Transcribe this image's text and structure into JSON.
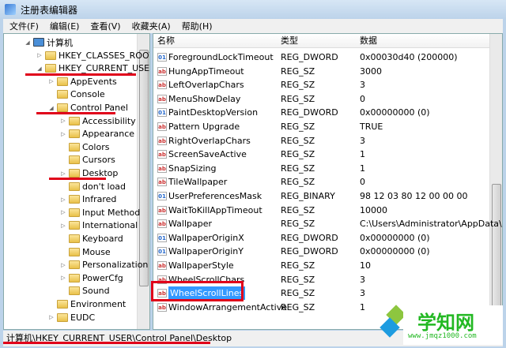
{
  "window": {
    "title": "注册表编辑器"
  },
  "menu": [
    "文件(F)",
    "编辑(E)",
    "查看(V)",
    "收藏夹(A)",
    "帮助(H)"
  ],
  "tree": [
    {
      "label": "计算机",
      "level": 0,
      "arrow": "◢",
      "icon": "computer"
    },
    {
      "label": "HKEY_CLASSES_ROOT",
      "level": 1,
      "arrow": "▷"
    },
    {
      "label": "HKEY_CURRENT_USER",
      "level": 1,
      "arrow": "◢"
    },
    {
      "label": "AppEvents",
      "level": 2,
      "arrow": "▷"
    },
    {
      "label": "Console",
      "level": 2,
      "arrow": ""
    },
    {
      "label": "Control Panel",
      "level": 2,
      "arrow": "◢"
    },
    {
      "label": "Accessibility",
      "level": 3,
      "arrow": "▷"
    },
    {
      "label": "Appearance",
      "level": 3,
      "arrow": "▷"
    },
    {
      "label": "Colors",
      "level": 3,
      "arrow": ""
    },
    {
      "label": "Cursors",
      "level": 3,
      "arrow": ""
    },
    {
      "label": "Desktop",
      "level": 3,
      "arrow": "▷"
    },
    {
      "label": "don't load",
      "level": 3,
      "arrow": ""
    },
    {
      "label": "Infrared",
      "level": 3,
      "arrow": "▷"
    },
    {
      "label": "Input Method",
      "level": 3,
      "arrow": "▷"
    },
    {
      "label": "International",
      "level": 3,
      "arrow": "▷"
    },
    {
      "label": "Keyboard",
      "level": 3,
      "arrow": ""
    },
    {
      "label": "Mouse",
      "level": 3,
      "arrow": ""
    },
    {
      "label": "Personalization",
      "level": 3,
      "arrow": "▷"
    },
    {
      "label": "PowerCfg",
      "level": 3,
      "arrow": "▷"
    },
    {
      "label": "Sound",
      "level": 3,
      "arrow": ""
    },
    {
      "label": "Environment",
      "level": 2,
      "arrow": ""
    },
    {
      "label": "EUDC",
      "level": 2,
      "arrow": "▷"
    }
  ],
  "columns": [
    "名称",
    "类型",
    "数据"
  ],
  "values": [
    {
      "name": "ForegroundLockTimeout",
      "type": "REG_DWORD",
      "data": "0x00030d40 (200000)",
      "icon": "bin"
    },
    {
      "name": "HungAppTimeout",
      "type": "REG_SZ",
      "data": "3000",
      "icon": "ab"
    },
    {
      "name": "LeftOverlapChars",
      "type": "REG_SZ",
      "data": "3",
      "icon": "ab"
    },
    {
      "name": "MenuShowDelay",
      "type": "REG_SZ",
      "data": "0",
      "icon": "ab"
    },
    {
      "name": "PaintDesktopVersion",
      "type": "REG_DWORD",
      "data": "0x00000000 (0)",
      "icon": "bin"
    },
    {
      "name": "Pattern Upgrade",
      "type": "REG_SZ",
      "data": "TRUE",
      "icon": "ab"
    },
    {
      "name": "RightOverlapChars",
      "type": "REG_SZ",
      "data": "3",
      "icon": "ab"
    },
    {
      "name": "ScreenSaveActive",
      "type": "REG_SZ",
      "data": "1",
      "icon": "ab"
    },
    {
      "name": "SnapSizing",
      "type": "REG_SZ",
      "data": "1",
      "icon": "ab"
    },
    {
      "name": "TileWallpaper",
      "type": "REG_SZ",
      "data": "0",
      "icon": "ab"
    },
    {
      "name": "UserPreferencesMask",
      "type": "REG_BINARY",
      "data": "98 12 03 80 12 00 00 00",
      "icon": "bin"
    },
    {
      "name": "WaitToKillAppTimeout",
      "type": "REG_SZ",
      "data": "10000",
      "icon": "ab"
    },
    {
      "name": "Wallpaper",
      "type": "REG_SZ",
      "data": "C:\\Users\\Administrator\\AppData\\",
      "icon": "ab"
    },
    {
      "name": "WallpaperOriginX",
      "type": "REG_DWORD",
      "data": "0x00000000 (0)",
      "icon": "bin"
    },
    {
      "name": "WallpaperOriginY",
      "type": "REG_DWORD",
      "data": "0x00000000 (0)",
      "icon": "bin"
    },
    {
      "name": "WallpaperStyle",
      "type": "REG_SZ",
      "data": "10",
      "icon": "ab"
    },
    {
      "name": "WheelScrollChars",
      "type": "REG_SZ",
      "data": "3",
      "icon": "ab"
    },
    {
      "name": "WheelScrollLines",
      "type": "REG_SZ",
      "data": "3",
      "icon": "ab",
      "selected": true
    },
    {
      "name": "WindowArrangementActive",
      "type": "REG_SZ",
      "data": "1",
      "icon": "ab"
    }
  ],
  "status": "计算机\\HKEY_CURRENT_USER\\Control Panel\\Desktop",
  "watermark": {
    "title": "学知网",
    "url": "www.jmqz1000.com"
  }
}
